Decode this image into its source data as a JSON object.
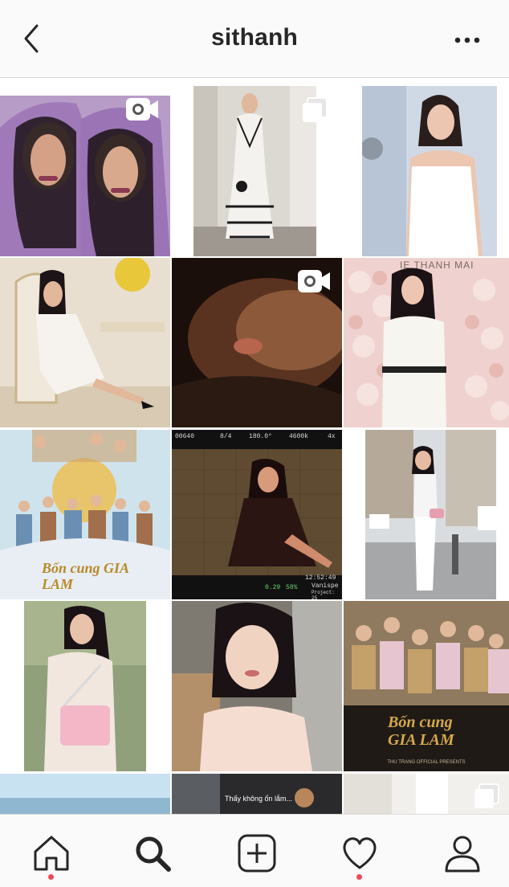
{
  "header": {
    "title": "sithanh",
    "back_icon": "chevron-left-icon",
    "more_icon": "more-horizontal-icon"
  },
  "grid": {
    "tiles": [
      {
        "id": "post-1",
        "badge": "video-icon"
      },
      {
        "id": "post-2",
        "badge": "carousel-icon"
      },
      {
        "id": "post-3",
        "badge": null
      },
      {
        "id": "post-4",
        "badge": null
      },
      {
        "id": "post-5",
        "badge": "video-icon"
      },
      {
        "id": "post-6",
        "badge": null,
        "overlay_text": "IE THANH MAI"
      },
      {
        "id": "post-7",
        "badge": null,
        "overlay_text": "Bốn cung GIA LAM"
      },
      {
        "id": "post-8",
        "badge": null,
        "camera_hud": [
          "00640",
          "8/4",
          "180.0°",
          "4600k",
          "4x",
          "0.29",
          "58%",
          "12:52:49",
          "Vanispe",
          "Project: 25"
        ]
      },
      {
        "id": "post-9",
        "badge": null
      },
      {
        "id": "post-10",
        "badge": null
      },
      {
        "id": "post-11",
        "badge": null
      },
      {
        "id": "post-12",
        "badge": null,
        "overlay_text": "Bốn cung GIA LAM",
        "caption": "THU TRANG OFFICIAL PRESENTS"
      },
      {
        "id": "post-13",
        "badge": null
      },
      {
        "id": "post-14",
        "badge": null,
        "overlay_text": "Thấy không ổn lắm..."
      },
      {
        "id": "post-15",
        "badge": "carousel-icon"
      }
    ]
  },
  "tabbar": {
    "tabs": [
      {
        "name": "home",
        "icon": "home-icon",
        "notification_dot": true
      },
      {
        "name": "search",
        "icon": "search-icon",
        "active": true
      },
      {
        "name": "new-post",
        "icon": "plus-square-icon"
      },
      {
        "name": "activity",
        "icon": "heart-icon",
        "notification_dot": true
      },
      {
        "name": "profile",
        "icon": "person-icon"
      }
    ],
    "dot_color": "#ed4956"
  }
}
